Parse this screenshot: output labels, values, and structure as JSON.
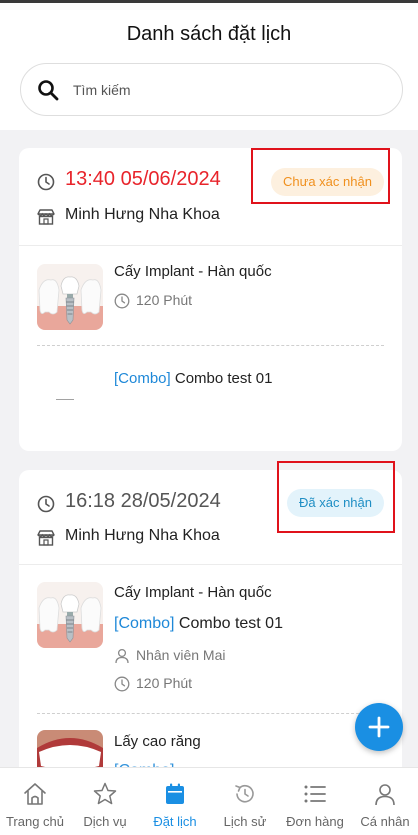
{
  "header": {
    "title": "Danh sách đặt lịch"
  },
  "search": {
    "placeholder": "Tìm kiếm"
  },
  "bookings": [
    {
      "time": "13:40 05/06/2024",
      "status": "Chưa xác nhận",
      "clinic": "Minh Hưng Nha Khoa",
      "services": [
        {
          "name": "Cấy Implant - Hàn quốc",
          "duration": "120 Phút"
        },
        {
          "combo_tag": "[Combo]",
          "name": " Combo test 01"
        }
      ]
    },
    {
      "time": "16:18 28/05/2024",
      "status": "Đã xác nhận",
      "clinic": "Minh Hưng Nha Khoa",
      "services": [
        {
          "name": "Cấy Implant - Hàn quốc",
          "combo_tag": "[Combo]",
          "combo_name": " Combo test 01",
          "staff": "Nhân viên Mai",
          "duration": "120 Phút"
        },
        {
          "name": "Lấy cao răng",
          "combo_tag": "[Combo]"
        }
      ]
    }
  ],
  "tabs": [
    {
      "label": "Trang chủ",
      "icon": "home-icon"
    },
    {
      "label": "Dịch vụ",
      "icon": "star-icon"
    },
    {
      "label": "Đặt lịch",
      "icon": "calendar-icon",
      "active": true
    },
    {
      "label": "Lịch sử",
      "icon": "history-icon"
    },
    {
      "label": "Đơn hàng",
      "icon": "list-icon"
    },
    {
      "label": "Cá nhân",
      "icon": "user-icon"
    }
  ],
  "colors": {
    "accent": "#1a8fe3",
    "time_red": "#e8242b",
    "pending": "#f0901e",
    "confirmed": "#1f8ec4",
    "highlight_box": "#e0121b"
  }
}
